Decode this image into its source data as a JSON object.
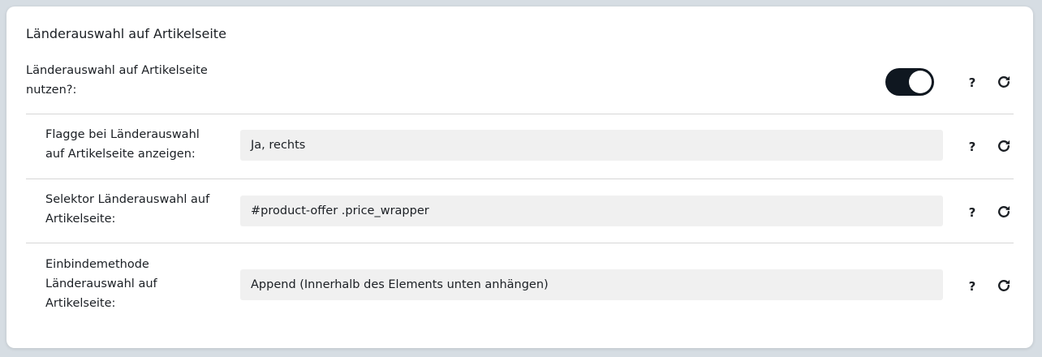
{
  "section": {
    "title": "Länderauswahl auf Artikelseite"
  },
  "toggle_row": {
    "label_line1": "Länderauswahl auf Artikelseite",
    "label_line2": "nutzen?:",
    "enabled": true,
    "help": "?"
  },
  "rows": [
    {
      "label_lines": [
        "Flagge bei Länderauswahl",
        "auf Artikelseite anzeigen:"
      ],
      "value": "Ja, rechts",
      "help": "?"
    },
    {
      "label_lines": [
        "Selektor Länderauswahl auf",
        "Artikelseite:"
      ],
      "value": "#product-offer .price_wrapper",
      "help": "?"
    },
    {
      "label_lines": [
        "Einbindemethode",
        "Länderauswahl auf",
        "Artikelseite:"
      ],
      "value": "Append (Innerhalb des Elements unten anhängen)",
      "help": "?"
    }
  ],
  "icons": {
    "help": "question-icon",
    "reset": "reset-icon"
  },
  "colors": {
    "toggle_on": "#0f1720",
    "field_bg": "#f0f0f0",
    "divider": "#d7d7d7"
  }
}
